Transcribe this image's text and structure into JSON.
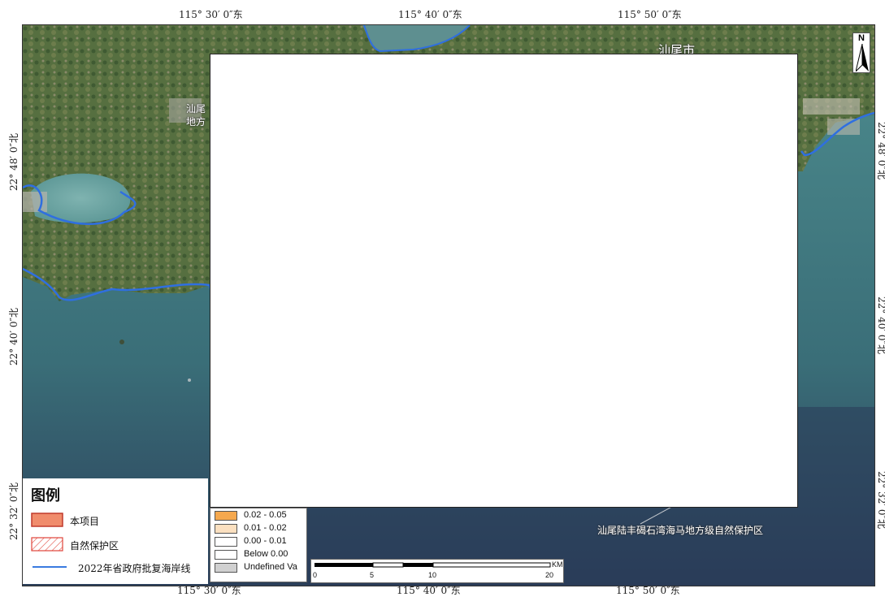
{
  "axes": {
    "top_ticks": [
      "115° 30′ 0″东",
      "115° 40′ 0″东",
      "115° 50′ 0″东"
    ],
    "bottom_ticks": [
      "115° 30′ 0″东",
      "115° 40′ 0″东",
      "115° 50′ 0″东"
    ],
    "left_ticks": [
      "22° 48′ 0″北",
      "22° 40′ 0″北",
      "22° 32′ 0″北"
    ],
    "right_ticks": [
      "22° 48′ 0″北",
      "22° 40′ 0″北",
      "22° 32′ 0″北"
    ]
  },
  "map_labels": {
    "town_left_line1": "汕尾",
    "town_left_line2": "地方",
    "top_partial": "汕尾市",
    "reserve_label": "汕尾陆丰碣石湾海马地方级自然保护区"
  },
  "north_arrow": {
    "letter": "N"
  },
  "legend": {
    "title": "图例",
    "items": [
      {
        "label": "本项目",
        "color": "#f08c6c",
        "kind": "fill"
      },
      {
        "label": "自然保护区",
        "color": "#e0443a",
        "kind": "hatch"
      },
      {
        "label": "2022年省政府批复海岸线",
        "color": "#3a7be0",
        "kind": "line"
      }
    ]
  },
  "classes": [
    {
      "label": "0.02 - 0.05",
      "color": "#f5a84e"
    },
    {
      "label": "0.01 - 0.02",
      "color": "#fbe0c0"
    },
    {
      "label": "0.00 - 0.01",
      "color": "#ffffff"
    },
    {
      "label": "Below 0.00",
      "color": "#ffffff"
    },
    {
      "label": "Undefined Va",
      "color": "#d0d0d0"
    }
  ],
  "scale_bar": {
    "unit": "KM",
    "labels": [
      "0",
      "5",
      "10",
      "20"
    ]
  },
  "colors": {
    "coastline": "#2f6fe0",
    "sea": "#3f7f86",
    "land": "#4f6a3c"
  }
}
